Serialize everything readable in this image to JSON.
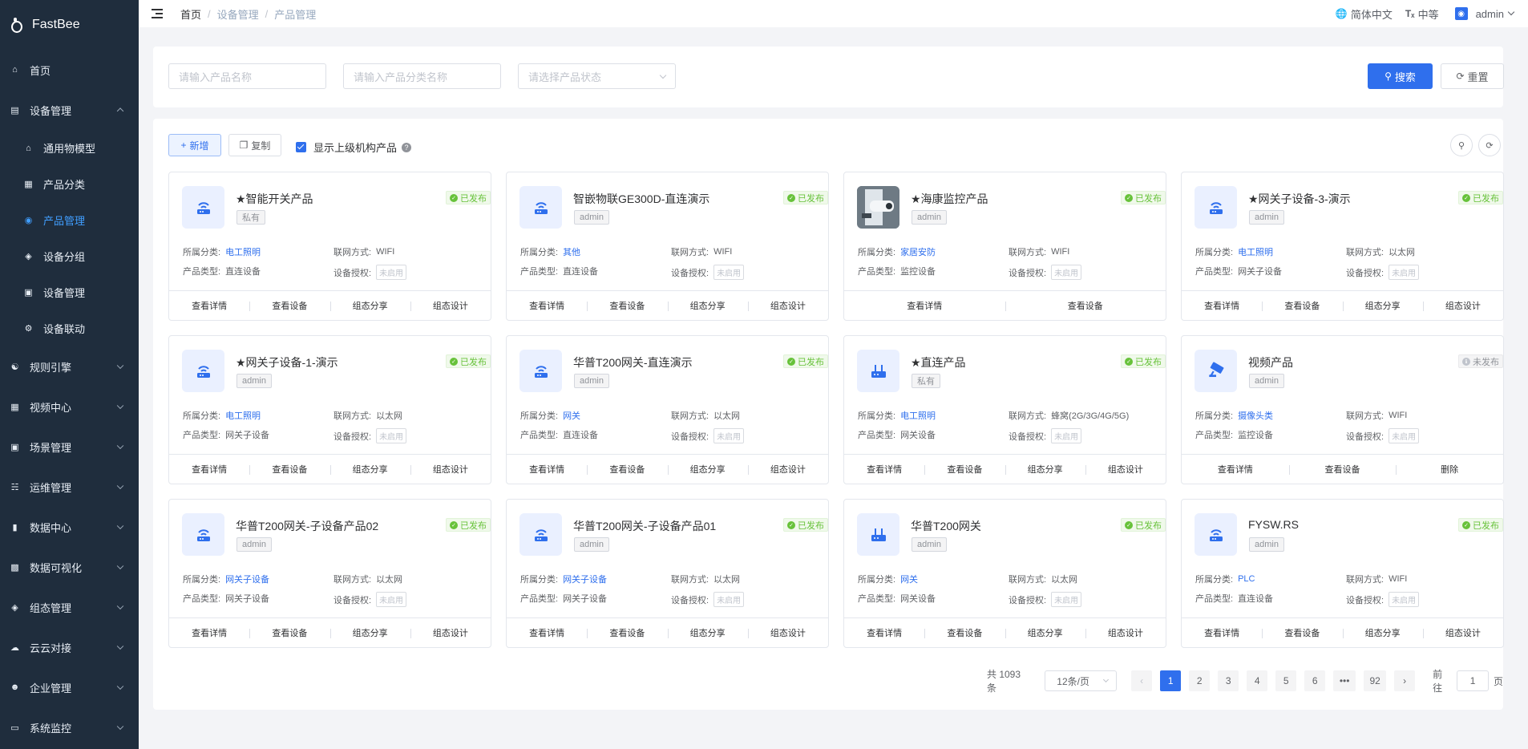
{
  "app": {
    "name": "FastBee"
  },
  "sidebar": {
    "items": [
      {
        "label": "首页",
        "icon": "home-icon"
      },
      {
        "label": "设备管理",
        "icon": "device-icon",
        "expanded": true
      },
      {
        "label": "规则引擎",
        "icon": "rule-icon"
      },
      {
        "label": "视频中心",
        "icon": "video-icon"
      },
      {
        "label": "场景管理",
        "icon": "scene-icon"
      },
      {
        "label": "运维管理",
        "icon": "ops-icon"
      },
      {
        "label": "数据中心",
        "icon": "data-icon"
      },
      {
        "label": "数据可视化",
        "icon": "visual-icon"
      },
      {
        "label": "组态管理",
        "icon": "scada-icon"
      },
      {
        "label": "云云对接",
        "icon": "cloud-icon"
      },
      {
        "label": "企业管理",
        "icon": "enterprise-icon"
      },
      {
        "label": "系统监控",
        "icon": "monitor-icon"
      }
    ],
    "sub_items": [
      {
        "label": "通用物模型",
        "icon": "model-icon"
      },
      {
        "label": "产品分类",
        "icon": "category-icon"
      },
      {
        "label": "产品管理",
        "icon": "product-icon",
        "active": true
      },
      {
        "label": "设备分组",
        "icon": "group-icon"
      },
      {
        "label": "设备管理",
        "icon": "device-manage-icon"
      },
      {
        "label": "设备联动",
        "icon": "linkage-icon"
      }
    ]
  },
  "navbar": {
    "breadcrumb": [
      "首页",
      "设备管理",
      "产品管理"
    ],
    "language": "简体中文",
    "font_size": "中等",
    "user": "admin"
  },
  "search": {
    "name_placeholder": "请输入产品名称",
    "category_placeholder": "请输入产品分类名称",
    "status_placeholder": "请选择产品状态",
    "search_label": "搜索",
    "reset_label": "重置"
  },
  "toolbar": {
    "add_label": "新增",
    "copy_label": "复制",
    "show_parent_label": "显示上级机构产品"
  },
  "labels": {
    "category": "所属分类:",
    "network": "联网方式:",
    "product_type": "产品类型:",
    "auth": "设备授权:",
    "auth_value": "未启用",
    "published": "已发布",
    "unpublished": "未发布"
  },
  "cards": [
    {
      "title": "★智能开关产品",
      "tag": "私有",
      "status": "published",
      "category": "电工照明",
      "network": "WIFI",
      "type": "直连设备",
      "icon": "wifi-router-icon",
      "actions": [
        "查看详情",
        "查看设备",
        "组态分享",
        "组态设计"
      ]
    },
    {
      "title": "智嵌物联GE300D-直连演示",
      "tag": "admin",
      "status": "published",
      "category": "其他",
      "network": "WIFI",
      "type": "直连设备",
      "icon": "wifi-router-icon",
      "actions": [
        "查看详情",
        "查看设备",
        "组态分享",
        "组态设计"
      ]
    },
    {
      "title": "★海康监控产品",
      "tag": "admin",
      "status": "published",
      "category": "家居安防",
      "network": "WIFI",
      "type": "监控设备",
      "icon": "camera-photo-icon",
      "actions": [
        "查看详情",
        "查看设备"
      ]
    },
    {
      "title": "★网关子设备-3-演示",
      "tag": "admin",
      "status": "published",
      "category": "电工照明",
      "network": "以太网",
      "type": "网关子设备",
      "icon": "wifi-router-icon",
      "actions": [
        "查看详情",
        "查看设备",
        "组态分享",
        "组态设计"
      ]
    },
    {
      "title": "★网关子设备-1-演示",
      "tag": "admin",
      "status": "published",
      "category": "电工照明",
      "network": "以太网",
      "type": "网关子设备",
      "icon": "wifi-router-icon",
      "actions": [
        "查看详情",
        "查看设备",
        "组态分享",
        "组态设计"
      ]
    },
    {
      "title": "华普T200网关-直连演示",
      "tag": "admin",
      "status": "published",
      "category": "网关",
      "network": "以太网",
      "type": "直连设备",
      "icon": "wifi-router-icon",
      "actions": [
        "查看详情",
        "查看设备",
        "组态分享",
        "组态设计"
      ]
    },
    {
      "title": "★直连产品",
      "tag": "私有",
      "status": "published",
      "category": "电工照明",
      "network": "蜂窝(2G/3G/4G/5G)",
      "type": "网关设备",
      "icon": "gateway-icon",
      "actions": [
        "查看详情",
        "查看设备",
        "组态分享",
        "组态设计"
      ]
    },
    {
      "title": "视频产品",
      "tag": "admin",
      "status": "unpublished",
      "category": "摄像头类",
      "network": "WIFI",
      "type": "监控设备",
      "icon": "camera-icon",
      "actions": [
        "查看详情",
        "查看设备",
        "删除"
      ]
    },
    {
      "title": "华普T200网关-子设备产品02",
      "tag": "admin",
      "status": "published",
      "category": "网关子设备",
      "network": "以太网",
      "type": "网关子设备",
      "icon": "wifi-router-icon",
      "actions": [
        "查看详情",
        "查看设备",
        "组态分享",
        "组态设计"
      ]
    },
    {
      "title": "华普T200网关-子设备产品01",
      "tag": "admin",
      "status": "published",
      "category": "网关子设备",
      "network": "以太网",
      "type": "网关子设备",
      "icon": "wifi-router-icon",
      "actions": [
        "查看详情",
        "查看设备",
        "组态分享",
        "组态设计"
      ]
    },
    {
      "title": "华普T200网关",
      "tag": "admin",
      "status": "published",
      "category": "网关",
      "network": "以太网",
      "type": "网关设备",
      "icon": "gateway-icon",
      "actions": [
        "查看详情",
        "查看设备",
        "组态分享",
        "组态设计"
      ]
    },
    {
      "title": "FYSW.RS",
      "tag": "admin",
      "status": "published",
      "category": "PLC",
      "network": "WIFI",
      "type": "直连设备",
      "icon": "wifi-router-icon",
      "actions": [
        "查看详情",
        "查看设备",
        "组态分享",
        "组态设计"
      ]
    }
  ],
  "pagination": {
    "total": "共 1093 条",
    "page_size": "12条/页",
    "pages": [
      "1",
      "2",
      "3",
      "4",
      "5",
      "6",
      "•••",
      "92"
    ],
    "current": "1",
    "goto_label": "前往",
    "goto_value": "1",
    "page_unit": "页"
  },
  "colors": {
    "primary": "#2f6fed",
    "sidebar": "#1f2d3d",
    "success": "#67c23a"
  }
}
